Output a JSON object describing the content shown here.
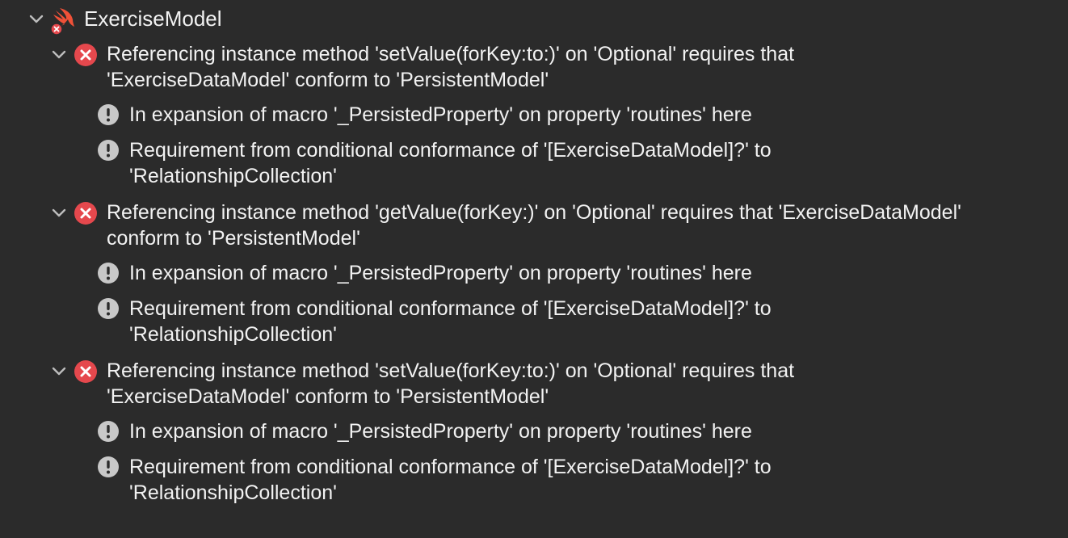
{
  "root": {
    "title": "ExerciseModel",
    "icon": "swift-file-icon",
    "badge": "error-badge"
  },
  "colors": {
    "background": "#2b2b2b",
    "text": "#f2f2f2",
    "error": "#e5484d",
    "note": "#c8c8c8",
    "chevron": "#bdbdbd"
  },
  "issues": [
    {
      "error": {
        "line1": "Referencing instance method 'setValue(forKey:to:)' on 'Optional' requires that",
        "line2": "'ExerciseDataModel' conform to 'PersistentModel'"
      },
      "notes": [
        {
          "line1": "In expansion of macro '_PersistedProperty' on property 'routines' here",
          "line2": ""
        },
        {
          "line1": "Requirement from conditional conformance of '[ExerciseDataModel]?' to",
          "line2": "'RelationshipCollection'"
        }
      ]
    },
    {
      "error": {
        "line1": "Referencing instance method 'getValue(forKey:)' on 'Optional' requires that 'ExerciseDataModel'",
        "line2": "conform to 'PersistentModel'"
      },
      "notes": [
        {
          "line1": "In expansion of macro '_PersistedProperty' on property 'routines' here",
          "line2": ""
        },
        {
          "line1": "Requirement from conditional conformance of '[ExerciseDataModel]?' to",
          "line2": "'RelationshipCollection'"
        }
      ]
    },
    {
      "error": {
        "line1": "Referencing instance method 'setValue(forKey:to:)' on 'Optional' requires that",
        "line2": "'ExerciseDataModel' conform to 'PersistentModel'"
      },
      "notes": [
        {
          "line1": "In expansion of macro '_PersistedProperty' on property 'routines' here",
          "line2": ""
        },
        {
          "line1": "Requirement from conditional conformance of '[ExerciseDataModel]?' to",
          "line2": "'RelationshipCollection'"
        }
      ]
    }
  ]
}
